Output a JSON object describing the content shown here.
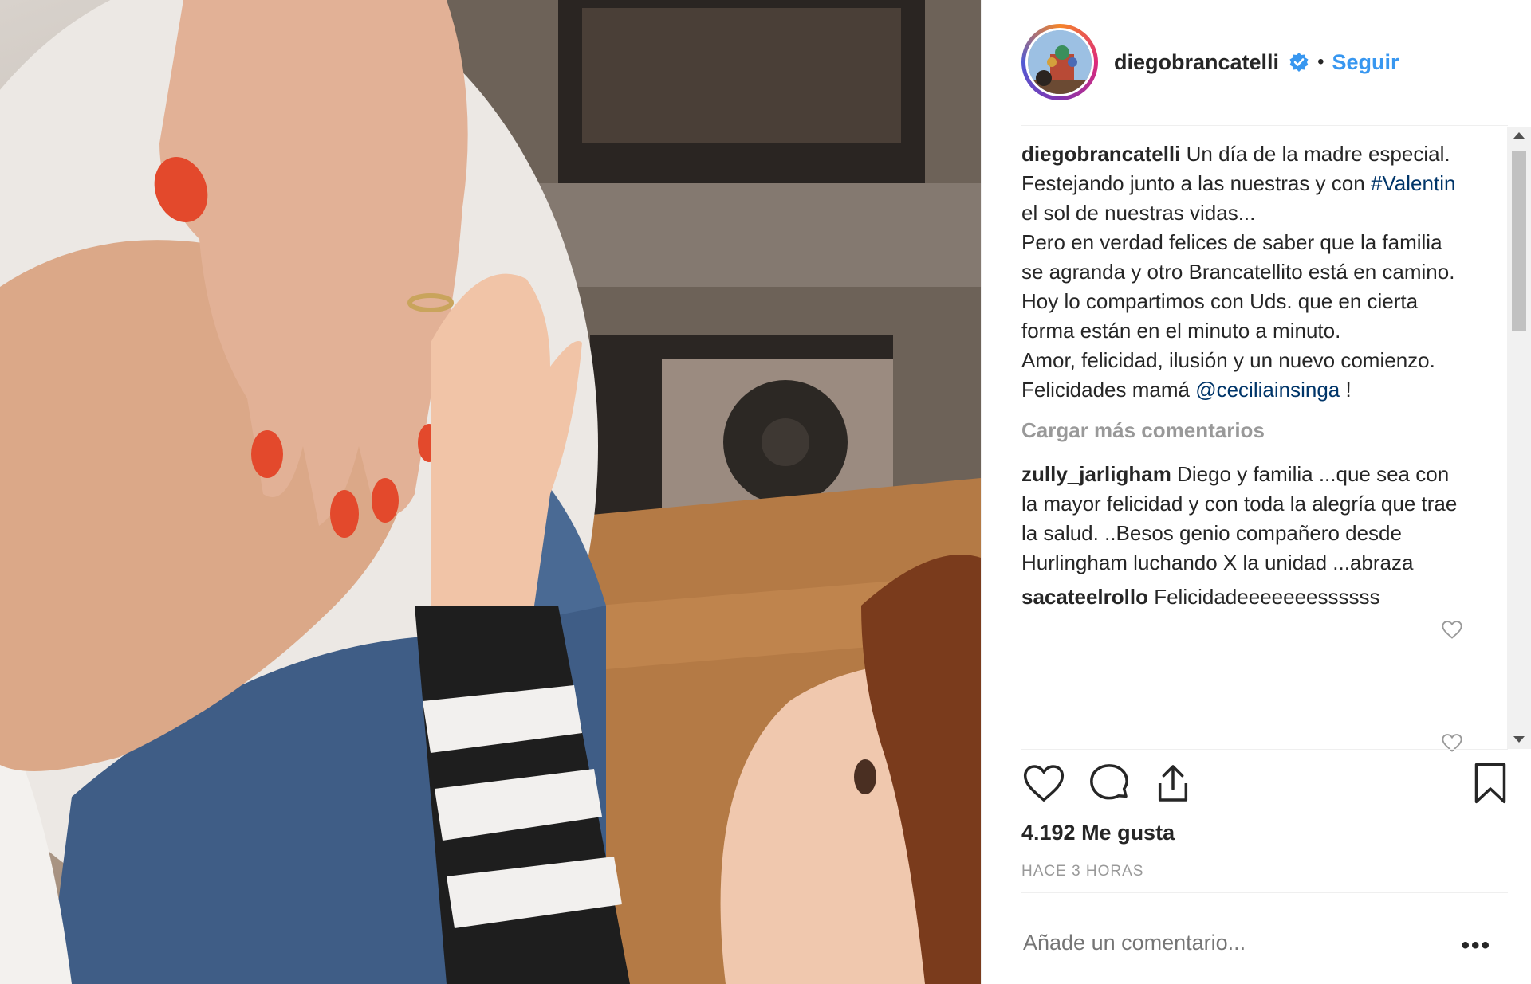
{
  "header": {
    "username": "diegobrancatelli",
    "separator": "•",
    "follow_label": "Seguir"
  },
  "caption": {
    "username": "diegobrancatelli",
    "text_1": "Un día de la madre especial.\nFestejando junto a las nuestras y con ",
    "hashtag": "#Valentin",
    "text_2": " el sol de nuestras vidas...\nPero en verdad felices de saber que la familia se agranda y otro Brancatellito está en camino. Hoy lo compartimos con Uds. que en cierta forma están en el minuto a minuto.\nAmor, felicidad, ilusión y un nuevo comienzo.\nFelicidades mamá ",
    "mention": "@ceciliainsinga",
    "text_3": " !"
  },
  "load_more_label": "Cargar más comentarios",
  "comments": [
    {
      "username": "zully_jarligham",
      "text": "Diego y familia ...que sea con la mayor felicidad y con toda la alegría que trae la salud. ..Besos genio compañero desde Hurlingham luchando X la unidad ...abraza"
    },
    {
      "username": "sacateelrollo",
      "text": "Felicidadeeeeeeessssss"
    }
  ],
  "likes": "4.192 Me gusta",
  "time": "HACE 3 HORAS",
  "add_comment_placeholder": "Añade un comentario...",
  "more_label": "•••",
  "icons": {
    "verified": "verified-badge-icon",
    "like": "heart-icon",
    "comment": "comment-icon",
    "share": "share-icon",
    "save": "bookmark-icon"
  },
  "colors": {
    "link": "#3897f0",
    "mention": "#003569",
    "muted": "#999999",
    "text": "#262626"
  }
}
